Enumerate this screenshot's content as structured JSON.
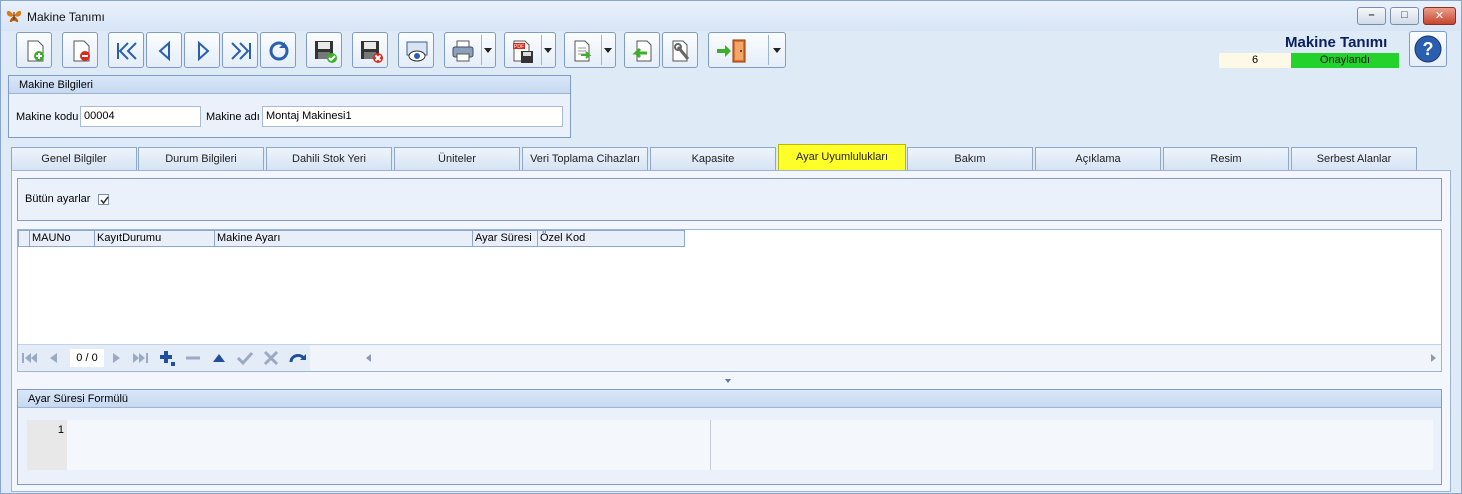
{
  "window": {
    "title": "Makine Tanımı",
    "minimize": "–",
    "maximize": "□",
    "close": "✕"
  },
  "toolbar": {
    "buttons": [
      {
        "name": "new-icon"
      },
      {
        "name": "delete-icon"
      },
      {
        "name": "first-record-icon"
      },
      {
        "name": "previous-record-icon"
      },
      {
        "name": "next-record-icon"
      },
      {
        "name": "last-record-icon"
      },
      {
        "name": "refresh-icon"
      },
      {
        "name": "save-icon"
      },
      {
        "name": "save-cancel-icon"
      },
      {
        "name": "preview-icon"
      },
      {
        "name": "print-icon"
      },
      {
        "name": "pdf-export-icon"
      },
      {
        "name": "export-icon"
      },
      {
        "name": "import-icon"
      },
      {
        "name": "tools-icon"
      },
      {
        "name": "exit-icon"
      }
    ]
  },
  "header": {
    "title": "Makine Tanımı",
    "counter": "6",
    "status": "Onaylandı",
    "status_color": "#23d32b"
  },
  "machine_info": {
    "group_title": "Makine Bilgileri",
    "code_label": "Makine kodu",
    "code_value": "00004",
    "name_label": "Makine adı",
    "name_value": "Montaj Makinesi1"
  },
  "tabs": [
    "Genel Bilgiler",
    "Durum Bilgileri",
    "Dahili Stok Yeri",
    "Üniteler",
    "Veri Toplama Cihazları",
    "Kapasite",
    "Ayar Uyumlulukları",
    "Bakım",
    "Açıklama",
    "Resim",
    "Serbest Alanlar"
  ],
  "active_tab": "Ayar Uyumlulukları",
  "settings": {
    "all_settings_label": "Bütün ayarlar",
    "all_settings_checked": true
  },
  "grid": {
    "columns": [
      "MAUNo",
      "KayıtDurumu",
      "Makine Ayarı",
      "Ayar Süresi",
      "Özel Kod"
    ],
    "rows": []
  },
  "navigator": {
    "position": "0 / 0"
  },
  "formula": {
    "group_title": "Ayar Süresi Formülü",
    "line_number": "1",
    "content": ""
  }
}
